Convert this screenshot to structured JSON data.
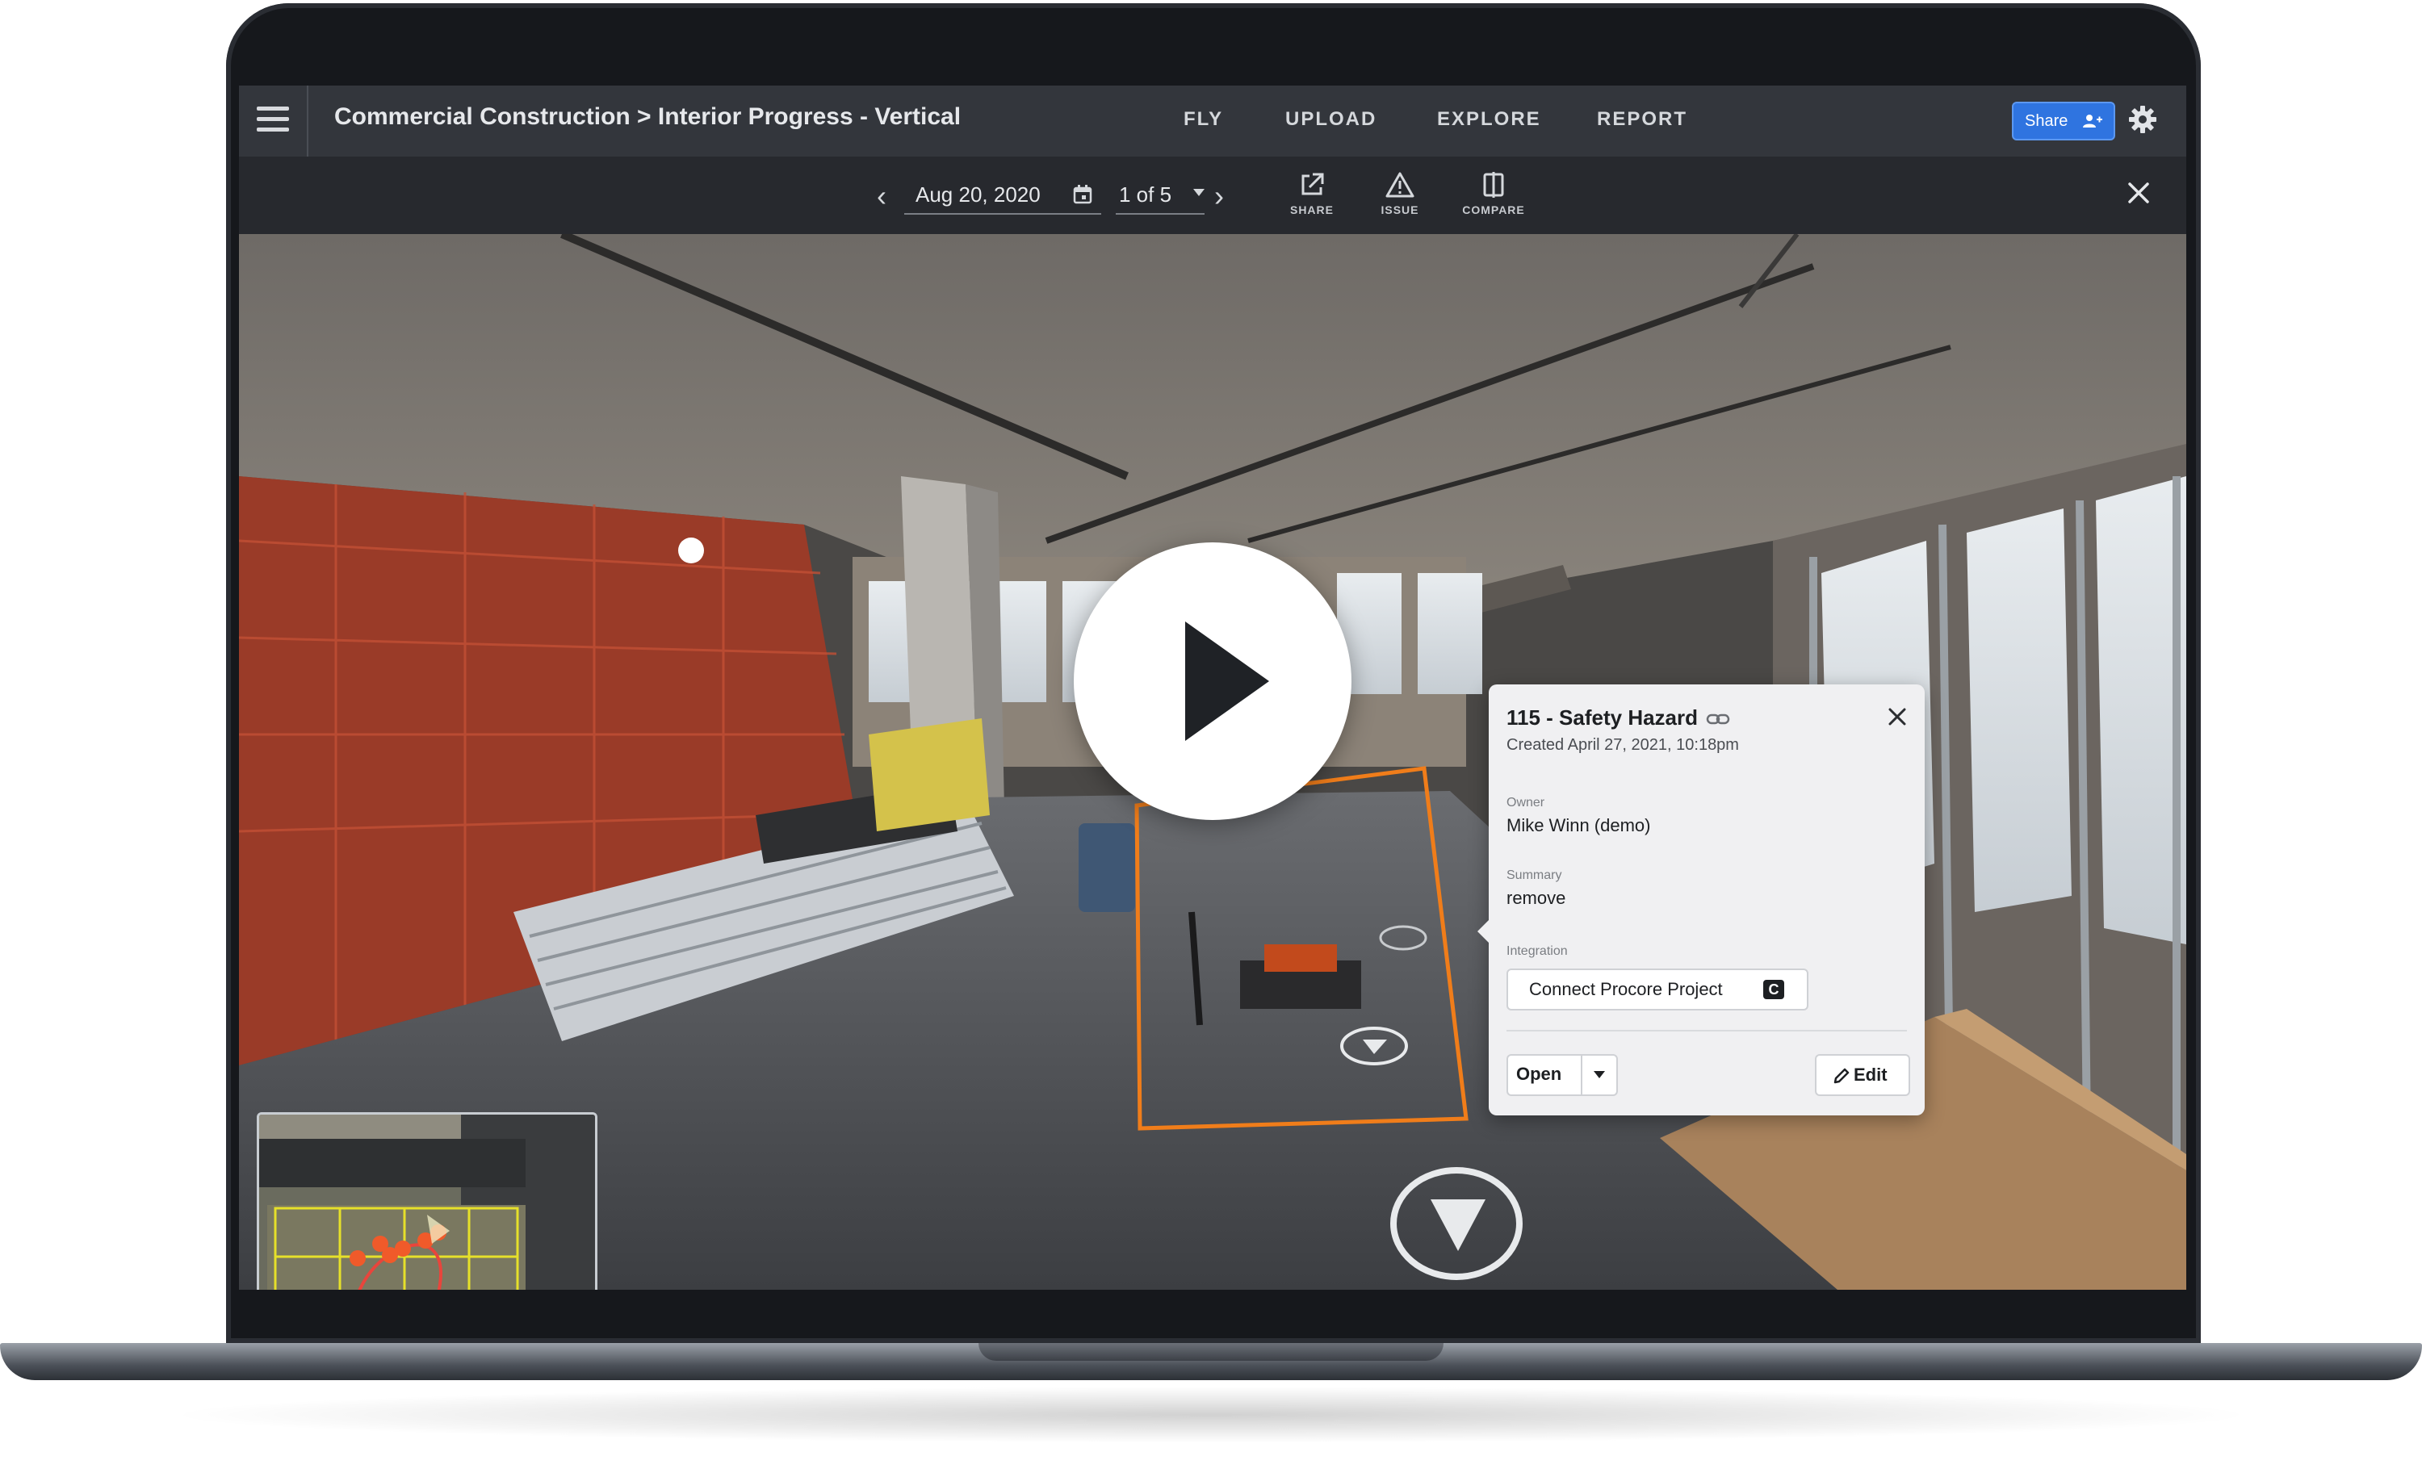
{
  "topbar": {
    "breadcrumb": "Commercial Construction > Interior Progress - Vertical",
    "nav": [
      "FLY",
      "UPLOAD",
      "EXPLORE",
      "REPORT"
    ],
    "share_label": "Share"
  },
  "toolbar": {
    "date": "Aug 20, 2020",
    "page": "1 of 5",
    "tools": {
      "share": "SHARE",
      "issue": "ISSUE",
      "compare": "COMPARE"
    }
  },
  "issue": {
    "title": "115 - Safety Hazard",
    "created": "Created April 27, 2021, 10:18pm",
    "owner_label": "Owner",
    "owner": "Mike Winn (demo)",
    "summary_label": "Summary",
    "summary": "remove",
    "integration_label": "Integration",
    "integration_button": "Connect Procore Project",
    "status": "Open",
    "edit_label": "Edit"
  },
  "colors": {
    "share_button": "#2f74e0",
    "highlight_box": "#f07d1a",
    "map_path": "#e8453c"
  },
  "icons": [
    "menu-icon",
    "settings-icon",
    "calendar-icon",
    "share-icon",
    "warning-icon",
    "compare-icon",
    "close-icon",
    "link-icon",
    "pencil-icon",
    "play-icon"
  ]
}
